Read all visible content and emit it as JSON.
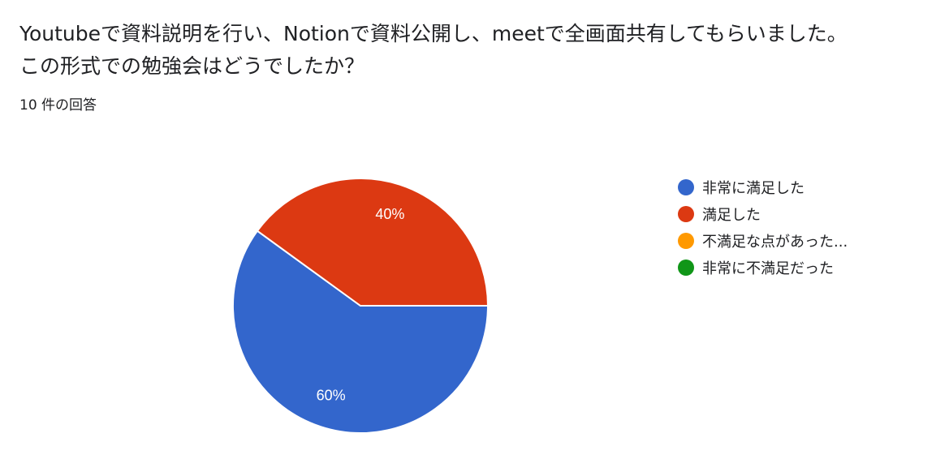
{
  "question": {
    "line1": "Youtubeで資料説明を行い、Notionで資料公開し、meetで全画面共有してもらいました。",
    "line2": "この形式での勉強会はどうでしたか？"
  },
  "response_count": "10 件の回答",
  "chart_data": {
    "type": "pie",
    "slices": [
      {
        "label": "非常に満足した",
        "legend_label": "非常に満足した",
        "value": 60,
        "data_label": "60%",
        "color": "#3366cc"
      },
      {
        "label": "満足した",
        "legend_label": "満足した",
        "value": 40,
        "data_label": "40%",
        "color": "#dc3912"
      },
      {
        "label": "不満足な点があった",
        "legend_label": "不満足な点があった...",
        "value": 0,
        "data_label": "",
        "color": "#ff9900"
      },
      {
        "label": "非常に不満足だった",
        "legend_label": "非常に不満足だった",
        "value": 0,
        "data_label": "",
        "color": "#109618"
      }
    ],
    "legend_position": "right"
  }
}
